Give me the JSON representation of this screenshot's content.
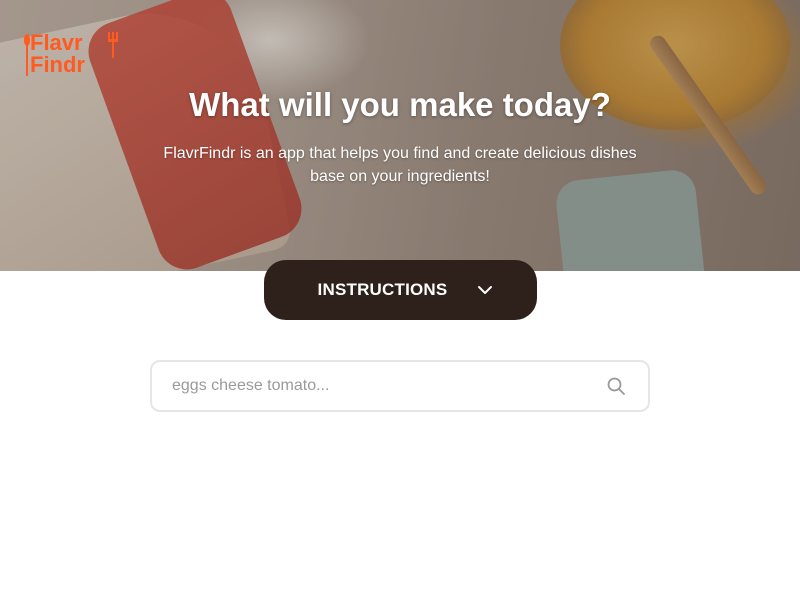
{
  "brand": {
    "logo_line1": "Flavr",
    "logo_line2": "Findr",
    "accent_color": "#ff5a1f"
  },
  "hero": {
    "headline": "What will you make today?",
    "subtext": "FlavrFindr is an app that helps you find and create delicious dishes base on your ingredients!"
  },
  "instructions": {
    "label": "INSTRUCTIONS",
    "icon": "chevron-down-icon",
    "color": "#2e201b"
  },
  "search": {
    "placeholder": "eggs cheese tomato...",
    "value": "",
    "icon": "search-icon"
  }
}
